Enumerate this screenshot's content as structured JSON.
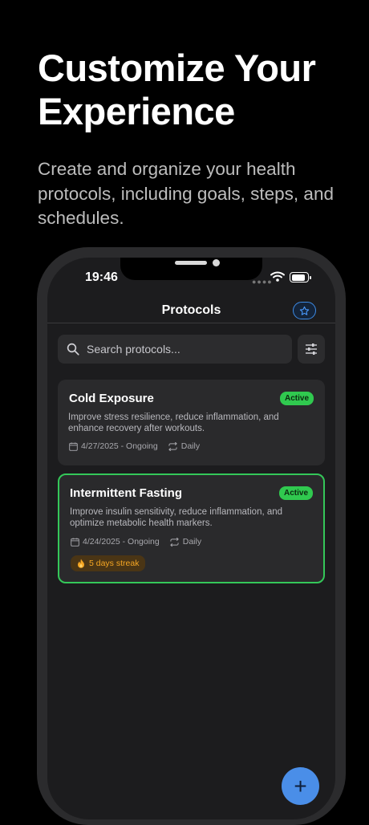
{
  "hero": {
    "title": "Customize Your Experience",
    "subtitle": "Create and organize your health protocols, including goals, steps, and schedules."
  },
  "status_bar": {
    "time": "19:46"
  },
  "nav": {
    "title": "Protocols"
  },
  "search": {
    "placeholder": "Search protocols..."
  },
  "protocols": [
    {
      "title": "Cold Exposure",
      "status": "Active",
      "description": "Improve stress resilience, reduce inflammation, and enhance recovery after workouts.",
      "dates": "4/27/2025 - Ongoing",
      "frequency": "Daily"
    },
    {
      "title": "Intermittent Fasting",
      "status": "Active",
      "description": "Improve insulin sensitivity, reduce inflammation, and optimize metabolic health markers.",
      "dates": "4/24/2025 - Ongoing",
      "frequency": "Daily",
      "streak": "5 days streak"
    }
  ],
  "fab": {
    "label": "+"
  },
  "colors": {
    "accent": "#4a8ee8",
    "active_badge": "#30c94f",
    "highlight_border": "#34c759",
    "streak": "#f5a623"
  }
}
